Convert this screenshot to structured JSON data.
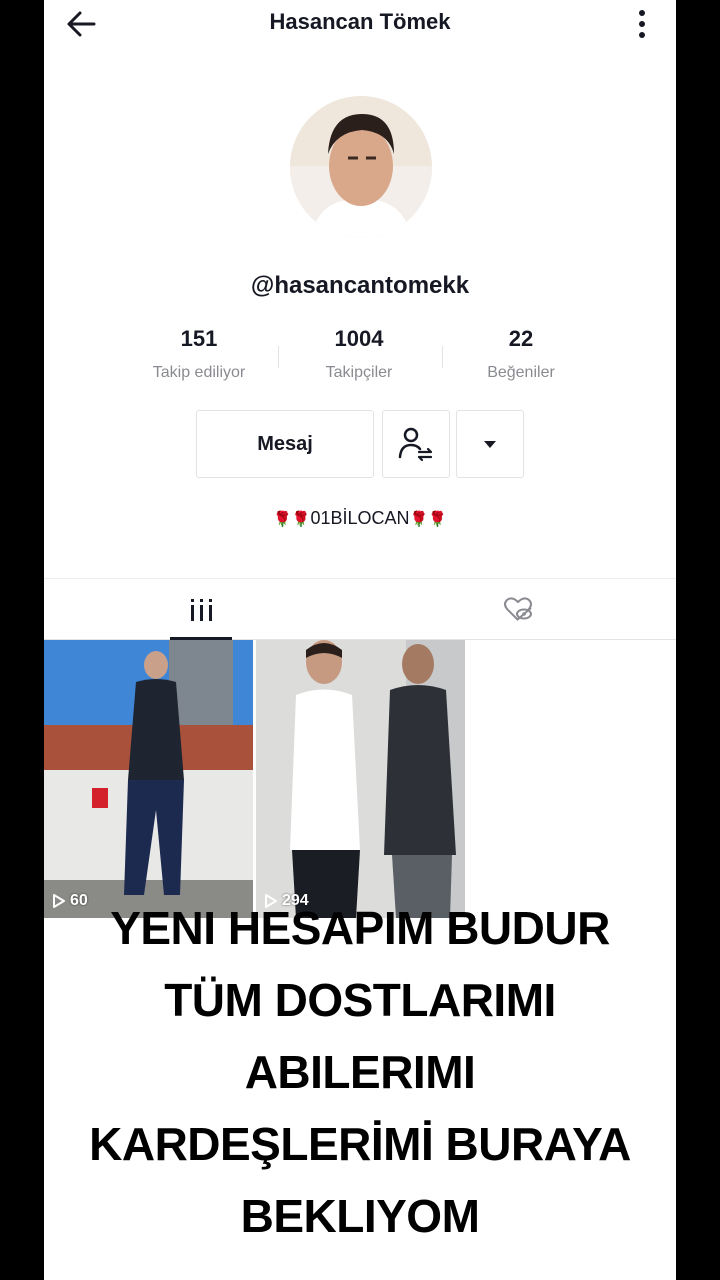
{
  "header": {
    "title": "Hasancan Tömek"
  },
  "profile": {
    "handle": "@hasancantomekk",
    "bio": "01BİLOCAN",
    "stats": [
      {
        "value": "151",
        "label": "Takip ediliyor"
      },
      {
        "value": "1004",
        "label": "Takipçiler"
      },
      {
        "value": "22",
        "label": "Beğeniler"
      }
    ]
  },
  "actions": {
    "message_label": "Mesaj"
  },
  "videos": [
    {
      "views": "60"
    },
    {
      "views": "294"
    }
  ],
  "caption": [
    "YENI HESAPIM BUDUR",
    "TÜM DOSTLARIMI",
    "ABILERIMI",
    "KARDEŞLERİMİ BURAYA",
    "BEKLIYOM"
  ],
  "icons": {
    "back": "arrow-left-icon",
    "more": "vertical-dots-icon",
    "follow": "user-switch-icon",
    "dropdown": "triangle-down-icon",
    "videos_tab": "grid-bars-icon",
    "liked_tab": "heart-hidden-icon",
    "play": "play-outline-icon",
    "rose": "rose-emoji"
  }
}
